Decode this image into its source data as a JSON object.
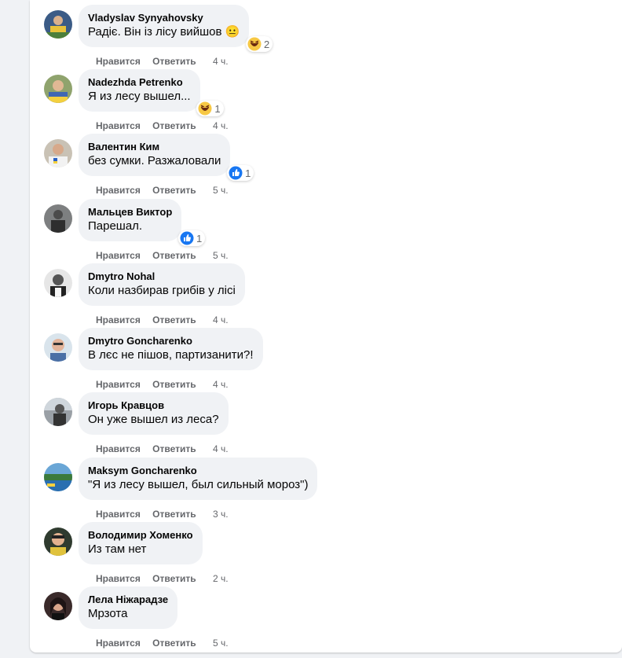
{
  "actions": {
    "like": "Нравится",
    "reply": "Ответить"
  },
  "comments": [
    {
      "author": "Vladyslav Synyahovsky",
      "text": "Радіє. Він із лісу вийшов",
      "emoji": "😐",
      "reaction": "haha",
      "count": "2",
      "time": "4 ч."
    },
    {
      "author": "Nadezhda Petrenko",
      "text": "Я из лесу вышел...",
      "reaction": "haha",
      "count": "1",
      "time": "4 ч."
    },
    {
      "author": "Валентин Ким",
      "text": "без сумки. Разжаловали",
      "reaction": "like",
      "count": "1",
      "time": "5 ч."
    },
    {
      "author": "Мальцев Виктор",
      "text": "Парешал.",
      "reaction": "like",
      "count": "1",
      "time": "5 ч."
    },
    {
      "author": "Dmytro Nohal",
      "text": "Коли назбирав грибів у лісі",
      "time": "4 ч."
    },
    {
      "author": "Dmytro Goncharenko",
      "text": "В лєс не пішов, партизанити?!",
      "time": "4 ч."
    },
    {
      "author": "Игорь Кравцов",
      "text": "Он уже вышел из леса?",
      "time": "4 ч."
    },
    {
      "author": "Maksym Goncharenko",
      "text": "\"Я из лесу вышел, был сильный мороз\")",
      "time": "3 ч."
    },
    {
      "author": "Володимир Хоменко",
      "text": "Из там нет",
      "time": "2 ч."
    },
    {
      "author": "Лела Ніжарадзе",
      "text": "Мрзота",
      "time": "5 ч."
    }
  ],
  "colors": {
    "like_blue": "#1877f2",
    "haha_yellow": "#f7c844",
    "meta_gray": "#65676b",
    "bubble_bg": "#f0f2f5"
  }
}
